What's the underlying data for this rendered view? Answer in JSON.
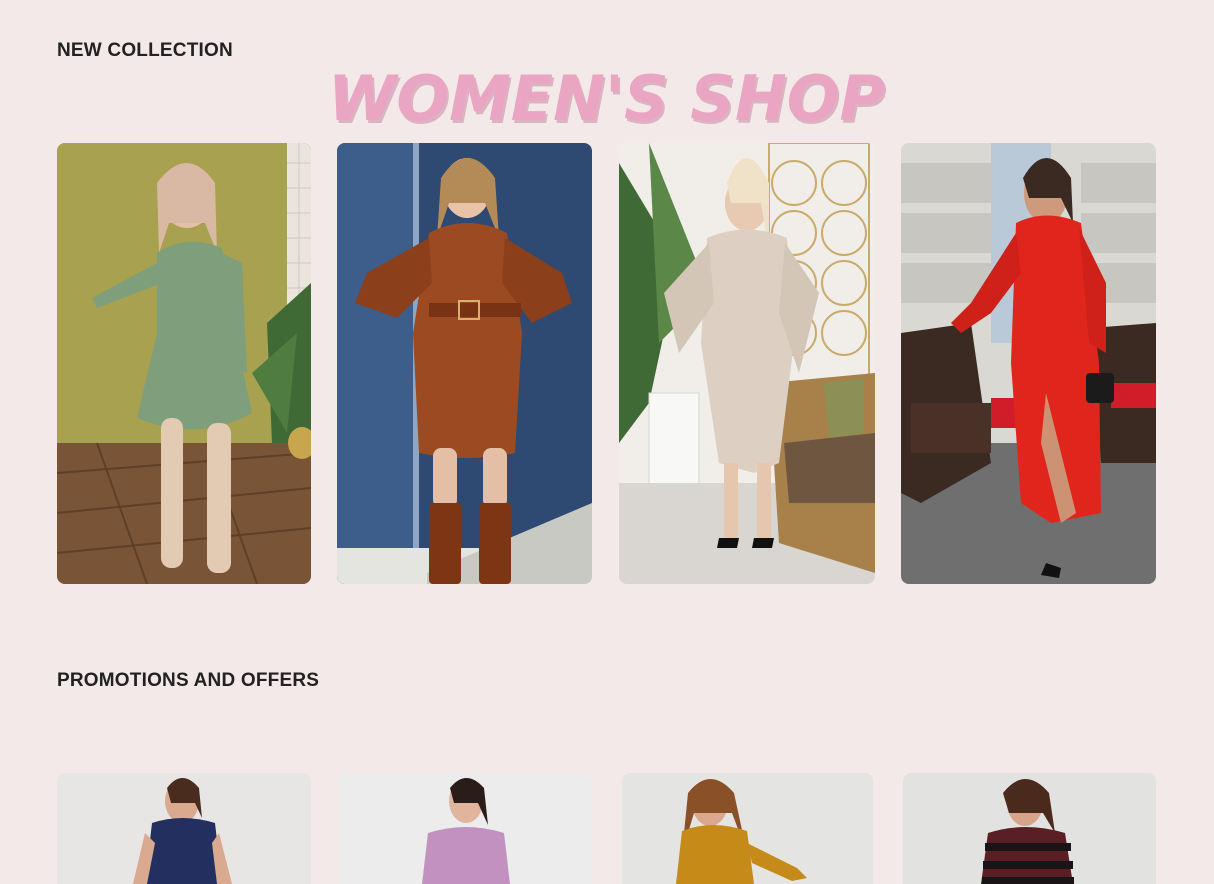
{
  "brand": {
    "name": "WOMEN'S SHOP",
    "color": "#e9a5c1"
  },
  "sections": {
    "new_collection": {
      "title": "NEW COLLECTION",
      "products": [
        {
          "image": "woman in sage green ruffle wrap dress with beige knee-high boots",
          "dress_color": "#7f9e7c"
        },
        {
          "image": "woman in rust brown faux-leather belted wrap dress with brown boots",
          "dress_color": "#9b4a22"
        },
        {
          "image": "woman in champagne satin wrap dress with black heels",
          "dress_color": "#ddd0c2"
        },
        {
          "image": "woman in red long wrap dress with black heels on a terrace",
          "dress_color": "#e0261c"
        }
      ]
    },
    "promotions": {
      "title": "PROMOTIONS AND OFFERS",
      "products": [
        {
          "image": "woman in navy lace dress",
          "dress_color": "#23305f"
        },
        {
          "image": "woman in lilac dress",
          "dress_color": "#c391c0"
        },
        {
          "image": "woman in mustard shirt dress",
          "dress_color": "#c68a18"
        },
        {
          "image": "woman in burgundy and black striped shirt",
          "dress_color": "#5a1f24"
        }
      ]
    }
  },
  "colors": {
    "page_background": "#f3e9e9",
    "heading_text": "#222222"
  }
}
